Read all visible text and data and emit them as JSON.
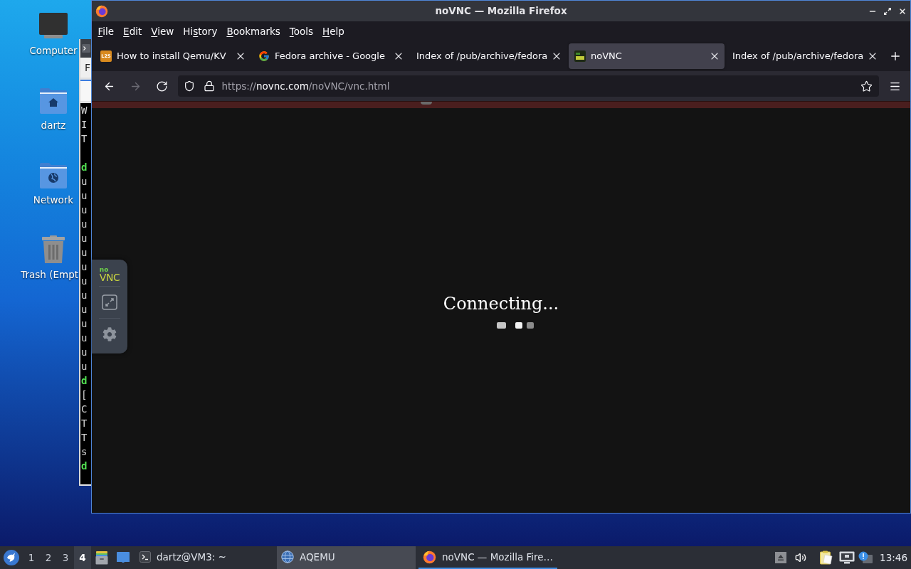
{
  "desktop_icons": [
    {
      "label": "Computer",
      "kind": "computer",
      "clipped": false
    },
    {
      "label": "dartz",
      "kind": "home",
      "clipped": false
    },
    {
      "label": "Network",
      "kind": "network",
      "clipped": false
    },
    {
      "label": "Trash (Empt",
      "kind": "trash",
      "clipped": true
    }
  ],
  "terminal": {
    "menu": [
      "F"
    ],
    "lines": [
      {
        "kind": "output",
        "text": "W"
      },
      {
        "kind": "output",
        "text": "I"
      },
      {
        "kind": "output",
        "text": "T"
      },
      {
        "kind": "blank"
      },
      {
        "kind": "prompt",
        "text": "d"
      },
      {
        "kind": "output",
        "text": "u"
      },
      {
        "kind": "output",
        "text": "u"
      },
      {
        "kind": "output",
        "text": "u"
      },
      {
        "kind": "output",
        "text": "u"
      },
      {
        "kind": "output",
        "text": "u"
      },
      {
        "kind": "output",
        "text": "u"
      },
      {
        "kind": "output",
        "text": "u"
      },
      {
        "kind": "output",
        "text": "u"
      },
      {
        "kind": "output",
        "text": "u"
      },
      {
        "kind": "output",
        "text": "u"
      },
      {
        "kind": "output",
        "text": "u"
      },
      {
        "kind": "output",
        "text": "u"
      },
      {
        "kind": "output",
        "text": "u"
      },
      {
        "kind": "output",
        "text": "u"
      },
      {
        "kind": "prompt",
        "text": "d"
      },
      {
        "kind": "output",
        "text": "["
      },
      {
        "kind": "output",
        "text": "C"
      },
      {
        "kind": "output",
        "text": "T"
      },
      {
        "kind": "output",
        "text": "T"
      },
      {
        "kind": "output",
        "text": "s"
      },
      {
        "kind": "prompt",
        "text": "d"
      }
    ]
  },
  "browser": {
    "title": "noVNC — Mozilla Firefox",
    "menu": [
      {
        "key": "F",
        "rest": "ile"
      },
      {
        "key": "E",
        "rest": "dit"
      },
      {
        "key": "V",
        "rest": "iew"
      },
      {
        "lead": "Hi",
        "key": "s",
        "rest": "tory"
      },
      {
        "key": "B",
        "rest": "ookmarks"
      },
      {
        "key": "T",
        "rest": "ools"
      },
      {
        "key": "H",
        "rest": "elp"
      }
    ],
    "tabs": [
      {
        "title": "How to install Qemu/KV",
        "kind": "lettered",
        "logo_text": "L2S",
        "selected": false
      },
      {
        "title": "Fedora archive - Google",
        "kind": "g_logo",
        "selected": false
      },
      {
        "title": "Index of /pub/archive/fedora",
        "kind": "plain",
        "selected": false
      },
      {
        "title": "noVNC",
        "kind": "tile",
        "selected": true
      },
      {
        "title": "Index of /pub/archive/fedora",
        "kind": "plain",
        "selected": false
      }
    ],
    "nav_buttons": [
      {
        "kind": "back",
        "disabled": false
      },
      {
        "kind": "forward",
        "disabled": true
      },
      {
        "kind": "reload",
        "disabled": false
      }
    ],
    "url": {
      "scheme": "https://",
      "host": "novnc.com",
      "path": "/noVNC/vnc.html"
    },
    "novnc": {
      "logo": {
        "top": "no",
        "bottom": "VNC"
      },
      "status": "Connecting..."
    }
  },
  "taskbar": {
    "workspaces": [
      {
        "label": "1",
        "selected": false
      },
      {
        "label": "2",
        "selected": false
      },
      {
        "label": "3",
        "selected": false
      },
      {
        "label": "4",
        "selected": true
      }
    ],
    "tasks": [
      {
        "label": "dartz@VM3: ~",
        "kind": "terminal",
        "selected": false,
        "highlighted": false
      },
      {
        "label": "AQEMU",
        "kind": "globe",
        "selected": false,
        "highlighted": true
      },
      {
        "label": "noVNC — Mozilla Fire…",
        "kind": "browser",
        "selected": true,
        "highlighted": false
      }
    ],
    "clock": "13:46"
  }
}
